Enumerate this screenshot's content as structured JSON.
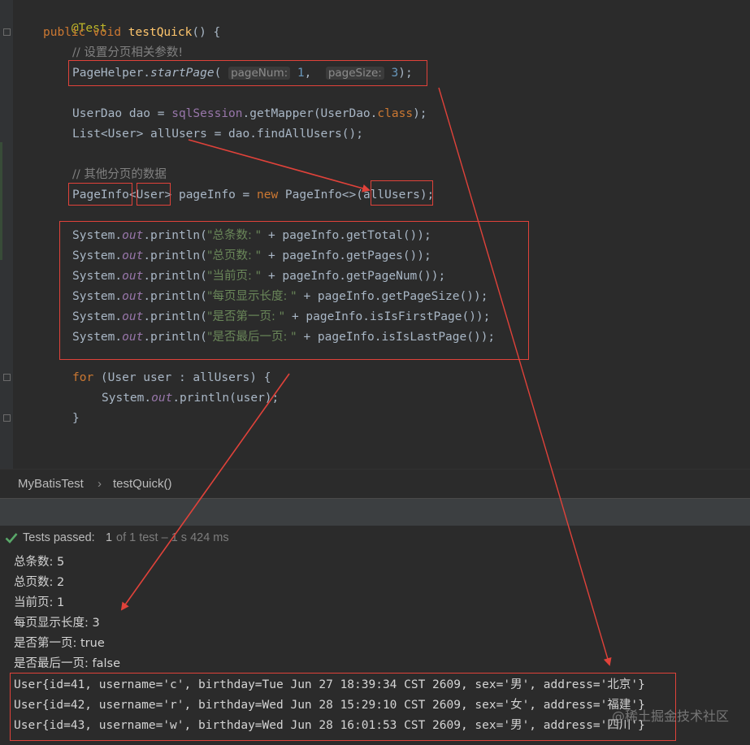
{
  "code": {
    "annotation": "@Test",
    "method_kw1": "public",
    "method_kw2": "void",
    "method_name": "testQuick",
    "method_tail": "() {",
    "comment1": "// 设置分页相关参数!",
    "start_page_call": "PageHelper.",
    "start_page_fn": "startPage",
    "paren_open": "(",
    "hint_page_num": "pageNum:",
    "val_page_num": "1",
    "comma": ",",
    "hint_page_size": "pageSize:",
    "val_page_size": "3",
    "paren_close": ");",
    "line_dao_a": "UserDao dao = ",
    "line_dao_b": "sqlSession",
    "line_dao_c": ".getMapper(UserDao.",
    "line_dao_d": "class",
    "line_dao_e": ");",
    "line_list": "List<User> allUsers = dao.findAllUsers();",
    "comment2": "// 其他分页的数据",
    "pi_type": "PageInfo",
    "pi_lt": "<",
    "pi_generic": "User",
    "pi_mid": "> pageInfo = ",
    "pi_new": "new",
    "pi_ctor": " PageInfo<>(",
    "pi_arg": "allUsers",
    "pi_end": ");",
    "sys": "System.",
    "out": "out",
    "println_open": ".println(",
    "print_lines": [
      {
        "str": "\"总条数: \"",
        "rest": " + pageInfo.getTotal());"
      },
      {
        "str": "\"总页数: \"",
        "rest": " + pageInfo.getPages());"
      },
      {
        "str": "\"当前页: \"",
        "rest": " + pageInfo.getPageNum());"
      },
      {
        "str": "\"每页显示长度: \"",
        "rest": " + pageInfo.getPageSize());"
      },
      {
        "str": "\"是否第一页: \"",
        "rest": " + pageInfo.isIsFirstPage());"
      },
      {
        "str": "\"是否最后一页: \"",
        "rest": " + pageInfo.isIsLastPage());"
      }
    ],
    "for_kw": "for",
    "for_rest": " (User user : allUsers) {",
    "for_body_rest": ".println(user);",
    "close_brace": "}"
  },
  "breadcrumb": {
    "class_name": "MyBatisTest",
    "separator": "›",
    "method_name": "testQuick()"
  },
  "status": {
    "label": "Tests passed:",
    "count": "1",
    "detail": "of 1 test – 1 s 424 ms"
  },
  "console": {
    "lines": [
      "总条数: 5",
      "总页数: 2",
      "当前页: 1",
      "每页显示长度: 3",
      "是否第一页: true",
      "是否最后一页: false"
    ],
    "user_lines": [
      "User{id=41, username='c', birthday=Tue Jun 27 18:39:34 CST 2609, sex='男', address='北京'}",
      "User{id=42, username='r', birthday=Wed Jun 28 15:29:10 CST 2609, sex='女', address='福建'}",
      "User{id=43, username='w', birthday=Wed Jun 28 16:01:53 CST 2609, sex='男', address='四川'}"
    ]
  },
  "watermark": "@稀土掘金技术社区",
  "colors": {
    "annotation_box": "#e0423a",
    "pass_check": "#59a869"
  }
}
